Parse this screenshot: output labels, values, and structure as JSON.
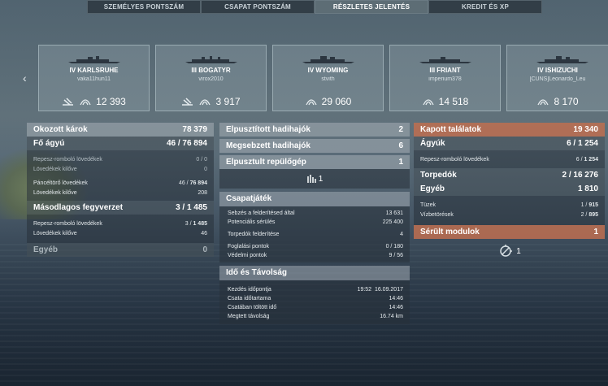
{
  "tabs": [
    {
      "label": "SZEMÉLYES PONTSZÁM"
    },
    {
      "label": "CSAPAT PONTSZÁM"
    },
    {
      "label": "RÉSZLETES JELENTÉS"
    },
    {
      "label": "KREDIT ÉS XP"
    }
  ],
  "nav": {
    "prev": "‹"
  },
  "ships": [
    {
      "name": "IV KARLSRUHE",
      "player": "vaka11hun11",
      "damage": "12 393"
    },
    {
      "name": "III BOGATYR",
      "player": "virox2010",
      "damage": "3 917"
    },
    {
      "name": "IV WYOMING",
      "player": "stvith",
      "damage": "29 060"
    },
    {
      "name": "III FRIANT",
      "player": "imperium378",
      "damage": "14 518"
    },
    {
      "name": "IV ISHIZUCHI",
      "player": "[CUNS]Leonardo_Leu",
      "damage": "8 170"
    }
  ],
  "left": {
    "total": {
      "label": "Okozott károk",
      "value": "78 379"
    },
    "main": {
      "label": "Fő ágyú",
      "value_a": "46 / ",
      "value_b": "76 894"
    },
    "he": {
      "label": "Repesz-romboló lövedékek",
      "value": "0 / 0"
    },
    "he_fired": {
      "label": "Lövedékek kilőve",
      "value": "0"
    },
    "ap": {
      "label": "Páncéltörő lövedékek",
      "value_a": "46 / ",
      "value_b": "76 894"
    },
    "ap_fired": {
      "label": "Lövedékek kilőve",
      "value": "208"
    },
    "secondary": {
      "label": "Másodlagos fegyverzet",
      "value_a": "3 / ",
      "value_b": "1 485"
    },
    "sec_he": {
      "label": "Repesz-romboló lövedékek",
      "value_a": "3 / ",
      "value_b": "1 485"
    },
    "sec_fired": {
      "label": "Lövedékek kilőve",
      "value": "46"
    },
    "other": {
      "label": "Egyéb",
      "value": "0"
    }
  },
  "middle": {
    "sunk": {
      "label": "Elpusztított hadihajók",
      "value": "2"
    },
    "damaged": {
      "label": "Megsebzett hadihajók",
      "value": "6"
    },
    "planes": {
      "label": "Elpusztult repülőgép",
      "value": "1"
    },
    "award": {
      "value": "1"
    },
    "team_title": "Csapatjáték",
    "team": [
      {
        "label": "Sebzés a felderítésed által",
        "value": "13 631"
      },
      {
        "label": "Potenciális sérülés",
        "value": "225 400"
      },
      {
        "label": "Torpedók felderítése",
        "value": "4"
      },
      {
        "label": "Foglalási pontok",
        "value": "0 / 180"
      },
      {
        "label": "Védelmi pontok",
        "value": "9 / 56"
      }
    ],
    "time_title": "Idő és Távolság",
    "time": [
      {
        "label": "Kezdés időpontja",
        "value": "19:52  16.09.2017"
      },
      {
        "label": "Csata időtartama",
        "value": "14:46"
      },
      {
        "label": "Csatában töltött idő",
        "value": "14:46"
      },
      {
        "label": "Megtett távolság",
        "value": "16.74 km"
      }
    ]
  },
  "right": {
    "received": {
      "label": "Kapott találatok",
      "value": "19 340"
    },
    "guns": {
      "label": "Ágyúk",
      "value_a": "6 / ",
      "value_b": "1 254"
    },
    "guns_he": {
      "label": "Repesz-romboló lövedékek",
      "value_a": "6 / ",
      "value_b": "1 254"
    },
    "torps": {
      "label": "Torpedók",
      "value_a": "2 / ",
      "value_b": "16 276"
    },
    "other": {
      "label": "Egyéb",
      "value": "1 810"
    },
    "fires": {
      "label": "Tüzek",
      "value_a": "1 / ",
      "value_b": "915"
    },
    "floods": {
      "label": "Vízbetörések",
      "value_a": "2 / ",
      "value_b": "895"
    },
    "modules": {
      "label": "Sérült modulok",
      "value": "1"
    },
    "module_count": {
      "value": "1"
    }
  }
}
